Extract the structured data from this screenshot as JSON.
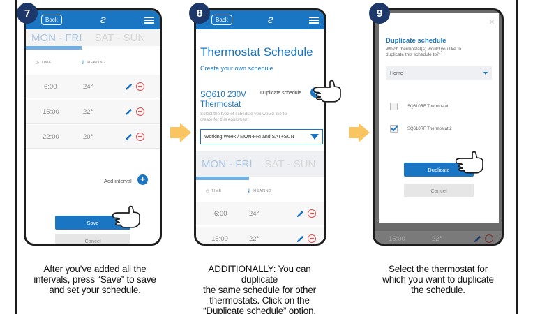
{
  "steps": [
    {
      "number": "7",
      "topbar": {
        "back": "Back",
        "logo": "ƨ"
      },
      "tabs": {
        "weekday": "MON - FRI",
        "weekend": "SAT - SUN"
      },
      "columns": {
        "time": "TIME",
        "heating": "HEATING"
      },
      "intervals": [
        {
          "time": "6:00",
          "temp": "24°"
        },
        {
          "time": "15:00",
          "temp": "22°"
        },
        {
          "time": "22:00",
          "temp": "20°"
        }
      ],
      "add_interval": "Add interval",
      "save": "Save",
      "cancel": "Cancel",
      "caption": [
        "After you’ve added all the",
        "intervals, press “Save” to save",
        "and set your schedule."
      ]
    },
    {
      "number": "8",
      "topbar": {
        "back": "Back",
        "logo": "ƨ"
      },
      "title": "Thermostat Schedule",
      "subtitle": "Create your own schedule",
      "device_name_1": "SQ610 230V",
      "device_name_2": "Thermostat",
      "duplicate": "Duplicate schedule",
      "hint_1": "Select the type of schedule you would like to",
      "hint_2": "create for this equipment",
      "dropdown": "Working Week / MON-FRI and SAT+SUN",
      "tabs": {
        "weekday": "MON - FRI",
        "weekend": "SAT - SUN"
      },
      "columns": {
        "time": "TIME",
        "heating": "HEATING"
      },
      "intervals": [
        {
          "time": "6:00",
          "temp": "24°"
        },
        {
          "time": "15:00",
          "temp": "22°"
        }
      ],
      "caption": [
        "ADDITIONALLY: You can duplicate",
        "the same schedule for other",
        "thermostats. Click on the",
        "“Duplicate schedule” option."
      ]
    },
    {
      "number": "9",
      "dialog": {
        "close": "×",
        "title": "Duplicate schedule",
        "text_1": "Which thermostat(s) would you like to",
        "text_2": "duplicate this schedule to?",
        "select": "Home",
        "options": [
          {
            "label": "SQ610RF Thermostat",
            "checked": false
          },
          {
            "label": "SQ610RF Thermostat 2",
            "checked": true
          }
        ],
        "duplicate": "Duplicate",
        "cancel": "Cancel"
      },
      "background_row": {
        "time": "15:00",
        "temp": "22°"
      },
      "caption": [
        "Select the thermostat for",
        "which you want to duplicate",
        "the schedule."
      ]
    }
  ],
  "colors": {
    "accent": "#1a75c2",
    "badge": "#1d3868",
    "arrow": "#f8c562",
    "remove": "#e05050"
  }
}
